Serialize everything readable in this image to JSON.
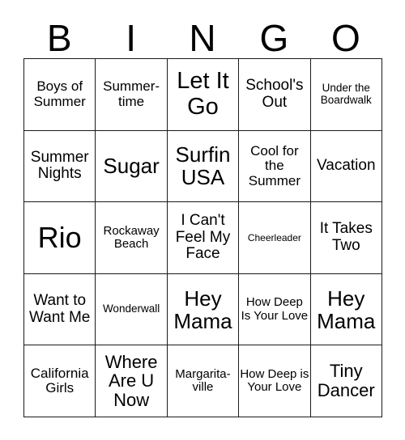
{
  "card": {
    "header_letters": [
      "B",
      "I",
      "N",
      "G",
      "O"
    ],
    "grid": [
      [
        {
          "text": "Boys of Summer",
          "size": "md"
        },
        {
          "text": "Summer-time",
          "size": "md"
        },
        {
          "text": "Let It Go",
          "size": "3xl"
        },
        {
          "text": "School's Out",
          "size": "lg"
        },
        {
          "text": "Under the Boardwalk",
          "size": "sm"
        }
      ],
      [
        {
          "text": "Summer Nights",
          "size": "lg"
        },
        {
          "text": "Sugar",
          "size": "xxl"
        },
        {
          "text": "Surfin USA",
          "size": "xxl"
        },
        {
          "text": "Cool for the Summer",
          "size": "md"
        },
        {
          "text": "Vacation",
          "size": "lg"
        }
      ],
      [
        {
          "text": "Rio",
          "size": "4xl"
        },
        {
          "text": "Rockaway Beach",
          "size": "smd"
        },
        {
          "text": "I Can't Feel My Face",
          "size": "lg"
        },
        {
          "text": "Cheerleader",
          "size": "xs"
        },
        {
          "text": "It Takes Two",
          "size": "lg"
        }
      ],
      [
        {
          "text": "Want to Want Me",
          "size": "lg"
        },
        {
          "text": "Wonderwall",
          "size": "sm"
        },
        {
          "text": "Hey Mama",
          "size": "xxl"
        },
        {
          "text": "How Deep Is Your Love",
          "size": "smd"
        },
        {
          "text": "Hey Mama",
          "size": "xxl"
        }
      ],
      [
        {
          "text": "California Girls",
          "size": "md"
        },
        {
          "text": "Where Are U Now",
          "size": "xl"
        },
        {
          "text": "Margarita-ville",
          "size": "smd"
        },
        {
          "text": "How Deep is Your Love",
          "size": "smd"
        },
        {
          "text": "Tiny Dancer",
          "size": "xl"
        }
      ]
    ]
  }
}
